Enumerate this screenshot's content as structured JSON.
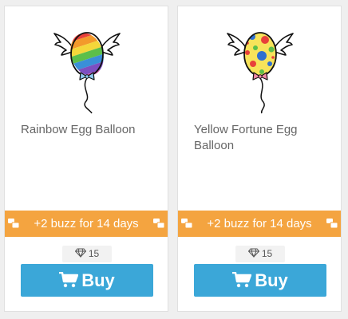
{
  "items": [
    {
      "name": "Rainbow Egg Balloon",
      "buzz_text": "+2 buzz for 14 days",
      "price": "15",
      "buy_label": "Buy",
      "image_icon": "rainbow-egg-balloon-icon"
    },
    {
      "name": "Yellow Fortune Egg Balloon",
      "buzz_text": "+2 buzz for 14 days",
      "price": "15",
      "buy_label": "Buy",
      "image_icon": "yellow-fortune-egg-balloon-icon"
    }
  ],
  "colors": {
    "buzz_bar": "#f4a440",
    "buy_button": "#3ba7d8",
    "card_background": "#ffffff",
    "page_background": "#efefef",
    "name_text": "#666666"
  },
  "icons": {
    "buzz": "chat-bubbles-icon",
    "currency": "diamond-icon",
    "buy": "shopping-cart-icon"
  }
}
